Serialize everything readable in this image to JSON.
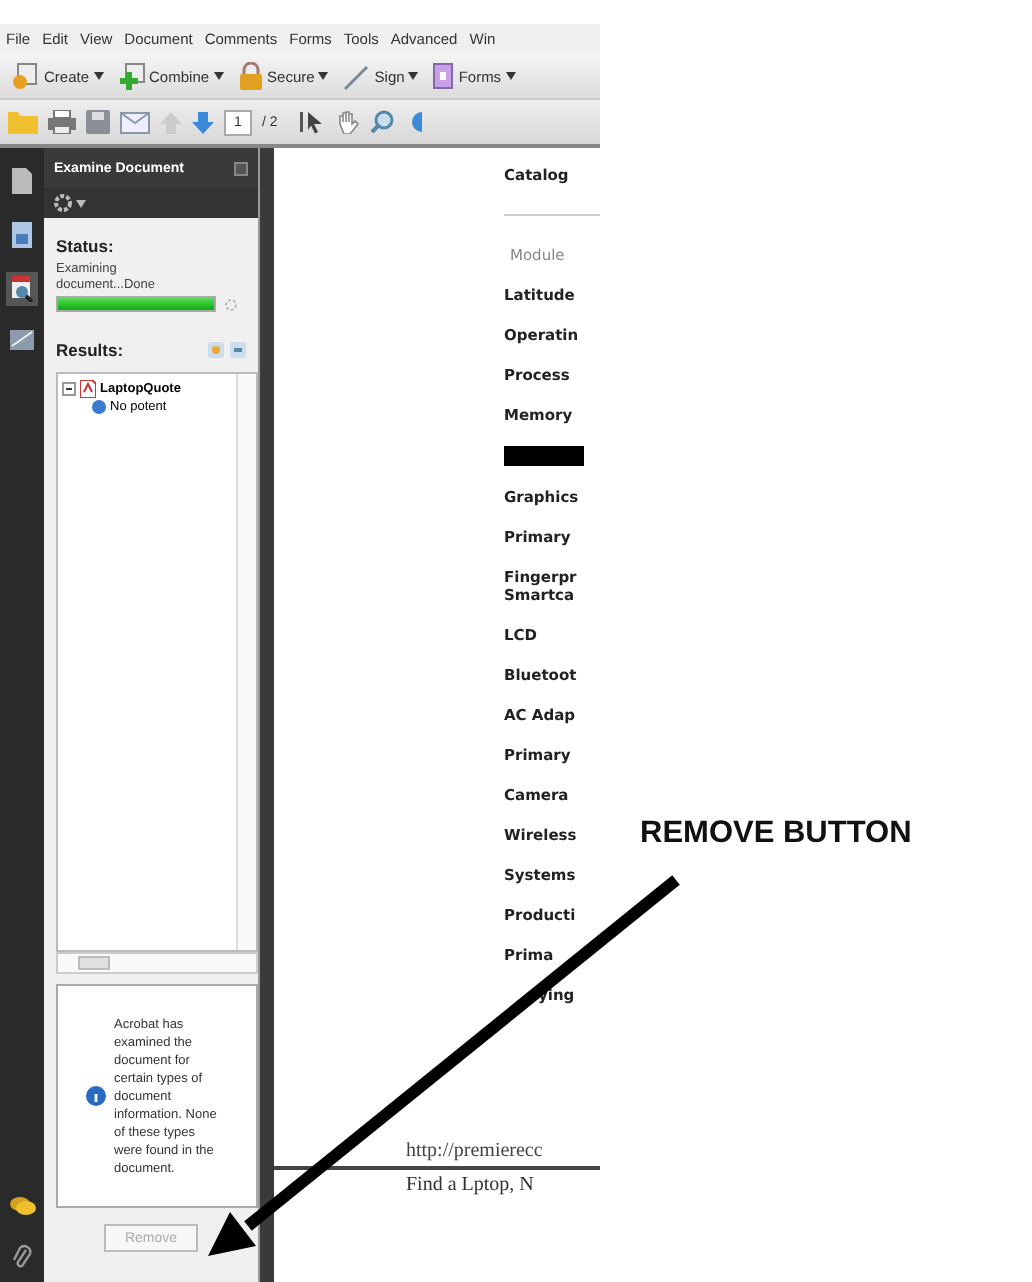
{
  "menu": [
    "File",
    "Edit",
    "View",
    "Document",
    "Comments",
    "Forms",
    "Tools",
    "Advanced",
    "Win"
  ],
  "toolbar": [
    {
      "label": "Create",
      "kind": "create"
    },
    {
      "label": "Combine",
      "kind": "combine"
    },
    {
      "label": "Secure",
      "kind": "secure"
    },
    {
      "label": "Sign",
      "kind": "sign"
    },
    {
      "label": "Forms",
      "kind": "forms"
    }
  ],
  "navigation": {
    "page": "1",
    "total": "/ 2"
  },
  "panel": {
    "title": "Examine Document",
    "status_label": "Status:",
    "status_text": "Examining document...Done",
    "progress": {
      "level": 1
    },
    "results_label": "Results:",
    "tree": [
      {
        "label": "LaptopQuote",
        "expanded": true,
        "children": [
          {
            "label": "No potent"
          }
        ]
      }
    ],
    "info": "Acrobat has examined the document for certain types of document information. None of these types were found in the document.",
    "remove_button": {
      "label": "Remove",
      "disabled": true
    }
  },
  "document": {
    "rows": [
      {
        "kind": "label",
        "text": "Catalog"
      },
      {
        "kind": "rule"
      },
      {
        "kind": "heading",
        "text": "Module"
      },
      {
        "kind": "label",
        "text": "Latitude"
      },
      {
        "kind": "label",
        "text": "Operatin"
      },
      {
        "kind": "label",
        "text": "Process"
      },
      {
        "kind": "label",
        "text": "Memory"
      },
      {
        "kind": "redacted"
      },
      {
        "kind": "label",
        "text": "Graphics"
      },
      {
        "kind": "label",
        "text": "Primary"
      },
      {
        "kind": "label",
        "text": "Fingerpr\nSmartca"
      },
      {
        "kind": "label",
        "text": "LCD"
      },
      {
        "kind": "label",
        "text": "Bluetoot"
      },
      {
        "kind": "label",
        "text": "AC Adap"
      },
      {
        "kind": "label",
        "text": "Primary"
      },
      {
        "kind": "label",
        "text": "Camera"
      },
      {
        "kind": "label",
        "text": "Wireless"
      },
      {
        "kind": "label",
        "text": "Systems"
      },
      {
        "kind": "label",
        "text": "Producti"
      },
      {
        "kind": "label",
        "text": "Prima"
      },
      {
        "kind": "label",
        "text": "ying"
      }
    ],
    "url": "http://premierecc",
    "footer": "Find a Lptop, N"
  },
  "annotation": {
    "label": "REMOVE BUTTON"
  }
}
